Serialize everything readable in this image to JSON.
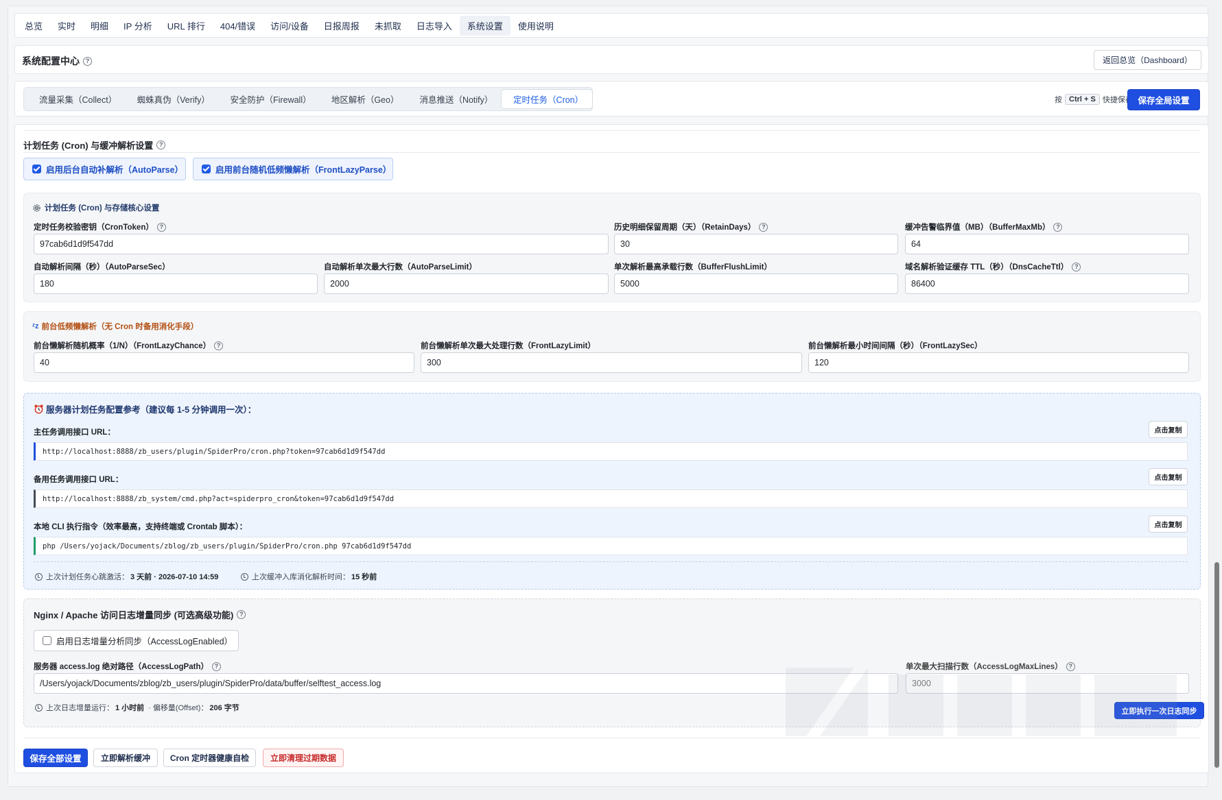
{
  "topnav": {
    "items": [
      "总览",
      "实时",
      "明细",
      "IP 分析",
      "URL 排行",
      "404/错误",
      "访问/设备",
      "日报周报",
      "未抓取",
      "日志导入",
      "系统设置",
      "使用说明"
    ],
    "active_index": 10
  },
  "header": {
    "title": "系统配置中心",
    "help": "?",
    "back_label": "返回总览（Dashboard）"
  },
  "tabs": {
    "items": [
      "流量采集（Collect）",
      "蜘蛛真伪（Verify）",
      "安全防护（Firewall）",
      "地区解析（Geo）",
      "消息推送（Notify）",
      "定时任务（Cron）"
    ],
    "active_index": 5,
    "hint_prefix": "按",
    "hint_key": "Ctrl + S",
    "hint_suffix": "快捷保存",
    "save_label": "保存全局设置"
  },
  "cron": {
    "section_title": "计划任务 (Cron) 与缓冲解析设置",
    "autoparse_label": "启用后台自动补解析（AutoParse）",
    "autoparse_checked": true,
    "frontlazy_label": "启用前台随机低频懒解析（FrontLazyParse）",
    "frontlazy_checked": true,
    "core": {
      "title": "计划任务 (Cron) 与存储核心设置",
      "icon": "gear-icon",
      "fields": {
        "cron_token_label": "定时任务校验密钥（CronToken）",
        "cron_token_value": "97cab6d1d9f547dd",
        "retain_days_label": "历史明细保留周期（天）（RetainDays）",
        "retain_days_value": "30",
        "buffer_max_label": "缓冲告警临界值（MB）（BufferMaxMb）",
        "buffer_max_value": "64",
        "autoparse_sec_label": "自动解析间隔（秒）（AutoParseSec）",
        "autoparse_sec_value": "180",
        "autoparse_limit_label": "自动解析单次最大行数（AutoParseLimit）",
        "autoparse_limit_value": "2000",
        "flush_limit_label": "单次解析最高承载行数（BufferFlushLimit）",
        "flush_limit_value": "5000",
        "dns_ttl_label": "域名解析验证缓存 TTL（秒）（DnsCacheTtl）",
        "dns_ttl_value": "86400"
      }
    },
    "lazy": {
      "title": "前台低频懒解析（无 Cron 时备用消化手段）",
      "icon": "sleep-icon",
      "chance_label": "前台懒解析随机概率（1/N）（FrontLazyChance）",
      "chance_value": "40",
      "limit_label": "前台懒解析单次最大处理行数（FrontLazyLimit）",
      "limit_value": "300",
      "sec_label": "前台懒解析最小时间间隔（秒）（FrontLazySec）",
      "sec_value": "120"
    },
    "reference": {
      "title": "服务器计划任务配置参考（建议每 1-5 分钟调用一次）：",
      "icon": "alarm-clock-icon",
      "copy_label": "点击复制",
      "main_label": "主任务调用接口 URL：",
      "main_url": "http://localhost:8888/zb_users/plugin/SpiderPro/cron.php?token=97cab6d1d9f547dd",
      "backup_label": "备用任务调用接口 URL：",
      "backup_url": "http://localhost:8888/zb_system/cmd.php?act=spiderpro_cron&token=97cab6d1d9f547dd",
      "cli_label": "本地 CLI 执行指令（效率最高，支持终端或 Crontab 脚本）：",
      "cli_cmd": "php /Users/yojack/Documents/zblog/zb_users/plugin/SpiderPro/cron.php 97cab6d1d9f547dd",
      "heartbeat_label": "上次计划任务心跳激活：",
      "heartbeat_value": "3 天前 · 2026-07-10 14:59",
      "flush_label": "上次缓冲入库消化解析时间：",
      "flush_value": "15 秒前"
    },
    "nginx": {
      "title": "Nginx / Apache 访问日志增量同步 (可选高级功能)",
      "enable_label": "启用日志增量分析同步（AccessLogEnabled）",
      "enable_checked": false,
      "path_label": "服务器 access.log 绝对路径（AccessLogPath）",
      "path_value": "/Users/yojack/Documents/zblog/zb_users/plugin/SpiderPro/data/buffer/selftest_access.log",
      "lines_label": "单次最大扫描行数（AccessLogMaxLines）",
      "lines_value": "3000",
      "last_run_label": "上次日志增量运行：",
      "last_run_value": "1 小时前",
      "offset_label": "· 偏移量(Offset)：",
      "offset_value": "206 字节",
      "run_label": "立即执行一次日志同步"
    },
    "actions": {
      "save_all": "保存全部设置",
      "parse_now": "立即解析缓冲",
      "health_check": "Cron 定时器健康自检",
      "purge": "立即清理过期数据"
    }
  },
  "colors": {
    "primary": "#1f4fe0",
    "danger": "#c62a2a",
    "orange_title": "#b34f12"
  }
}
